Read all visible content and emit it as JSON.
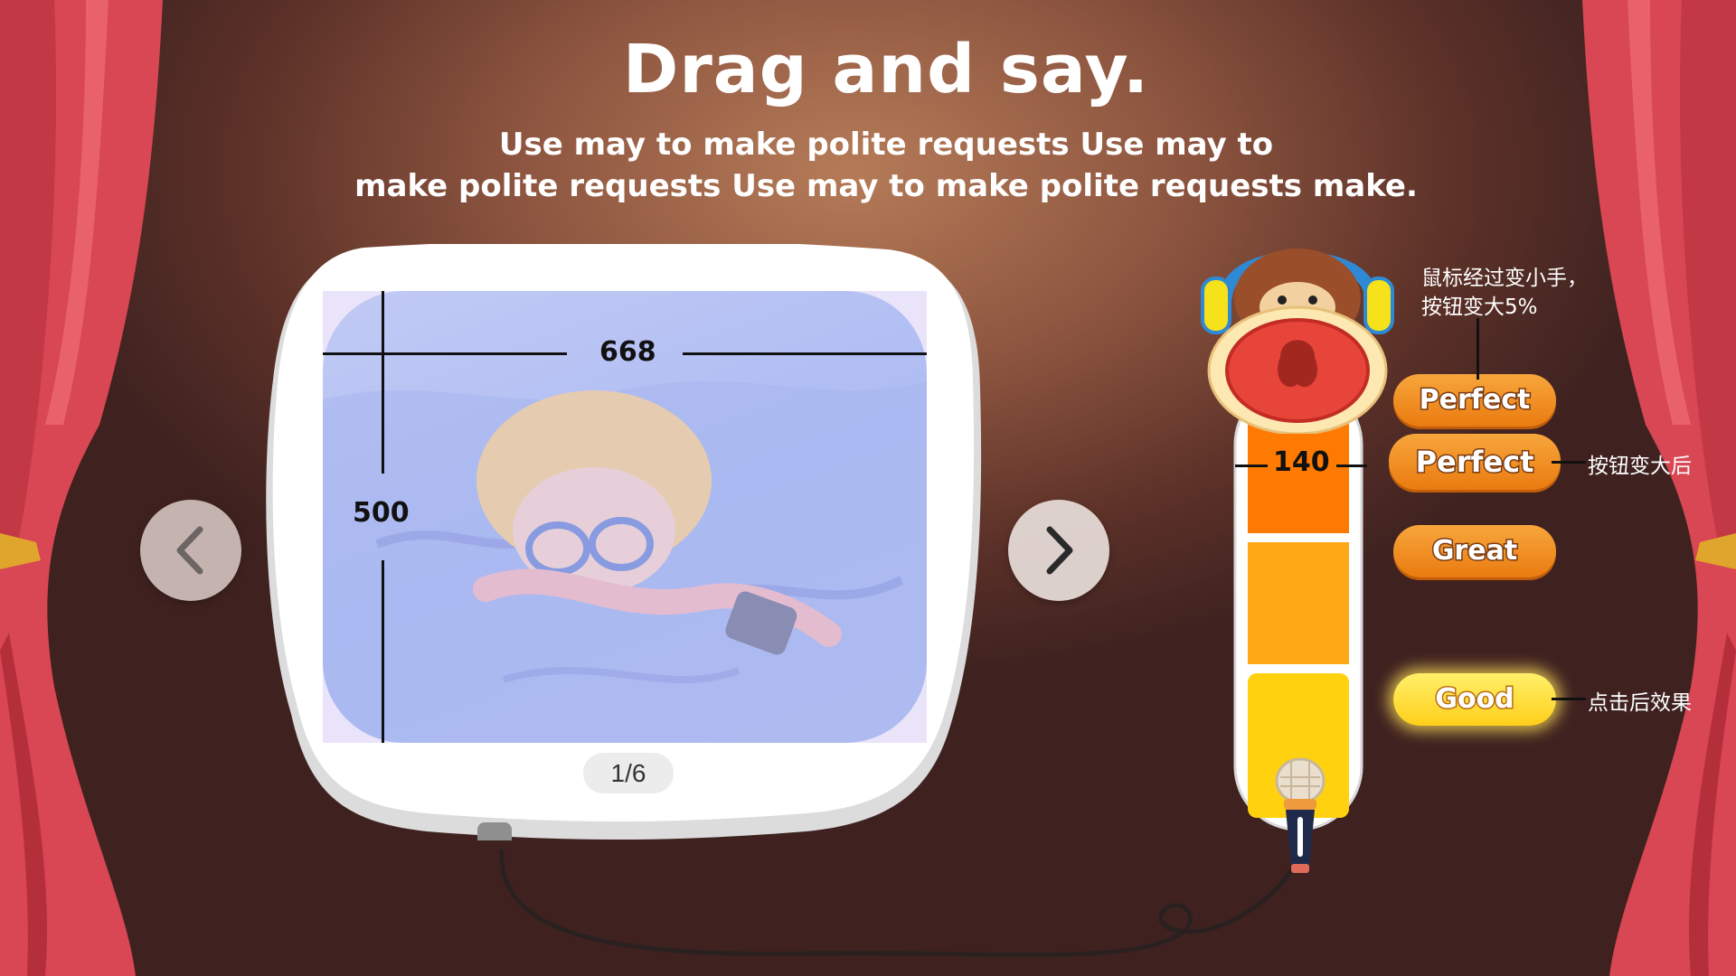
{
  "title": "Drag and say.",
  "subtitle_line1": "Use may to make polite requests Use may to",
  "subtitle_line2": "make polite requests Use may to make polite requests make.",
  "image_width_label": "668",
  "image_height_label": "500",
  "pager": "1/6",
  "meter_height_label": "140",
  "buttons": {
    "perfect_default": "Perfect",
    "perfect_enlarged": "Perfect",
    "great": "Great",
    "good": "Good"
  },
  "notes": {
    "hover_line1": "鼠标经过变小手，",
    "hover_line2": "按钮变大5%",
    "enlarged": "按钮变大后",
    "clicked": "点击后效果"
  },
  "icons": {
    "prev": "chevron-left-icon",
    "next": "chevron-right-icon",
    "mascot": "monkey-mascot-icon",
    "microphone": "microphone-icon"
  },
  "colors": {
    "button_orange": "#f08a1c",
    "button_yellow": "#ffd42a",
    "curtain": "#d94a55"
  }
}
